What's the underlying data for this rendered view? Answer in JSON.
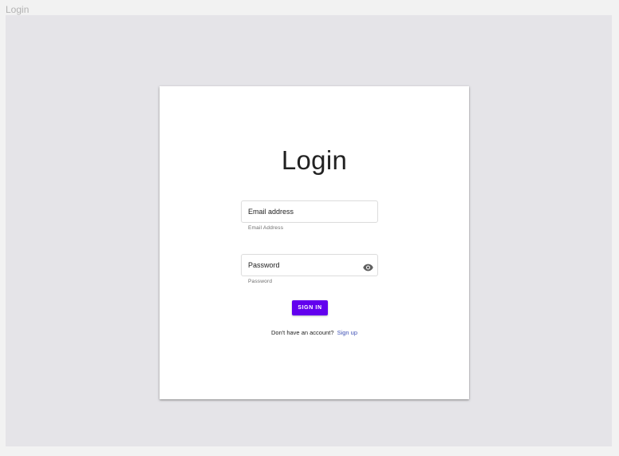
{
  "frame": {
    "label": "Login"
  },
  "card": {
    "title": "Login",
    "email": {
      "placeholder": "Email address",
      "helper": "Email Address"
    },
    "password": {
      "placeholder": "Password",
      "helper": "Password",
      "toggle_icon": "eye-icon"
    },
    "sign_in_label": "SIGN IN",
    "signup_prompt": "Don't have an account?",
    "signup_link": "Sign up"
  },
  "colors": {
    "primary": "#6200ee",
    "link": "#3f51b5",
    "canvas": "#e5e4e8",
    "page": "#f2f2f2"
  }
}
